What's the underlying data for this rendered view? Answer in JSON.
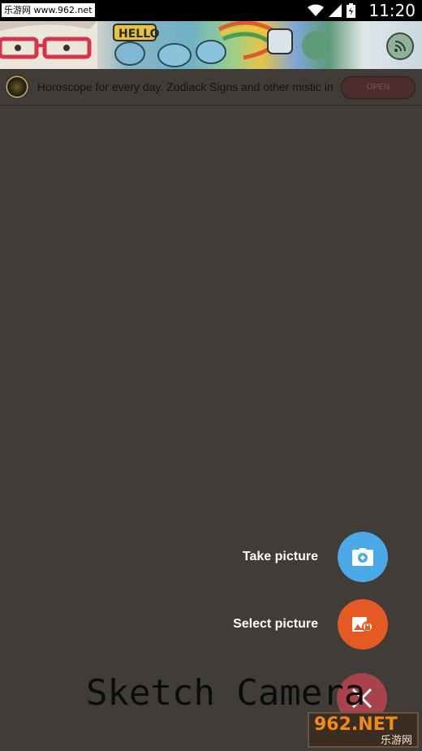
{
  "status_bar": {
    "watermark": "乐游网 www.962.net",
    "time": "11:20",
    "icons": [
      "wifi-icon",
      "signal-icon",
      "battery-icon"
    ]
  },
  "banner": {
    "text": "HELLO",
    "rss_icon": "rss-icon"
  },
  "ad": {
    "text": "Horoscope for every day. Zodiack Signs and other mistic in",
    "button": "OPEN"
  },
  "menu": {
    "items": [
      {
        "label": "Take picture",
        "icon": "camera-plus-icon",
        "color": "#4aa9e6"
      },
      {
        "label": "Select picture",
        "icon": "image-gallery-icon",
        "color": "#e45a22"
      }
    ],
    "close_icon": "close-icon",
    "close_color": "#a8434b"
  },
  "app_title": "Sketch Camera",
  "watermark_bottom": {
    "big": "962.NET",
    "small": "乐游网"
  },
  "colors": {
    "background": "#403c37",
    "statusbar": "#000000"
  }
}
